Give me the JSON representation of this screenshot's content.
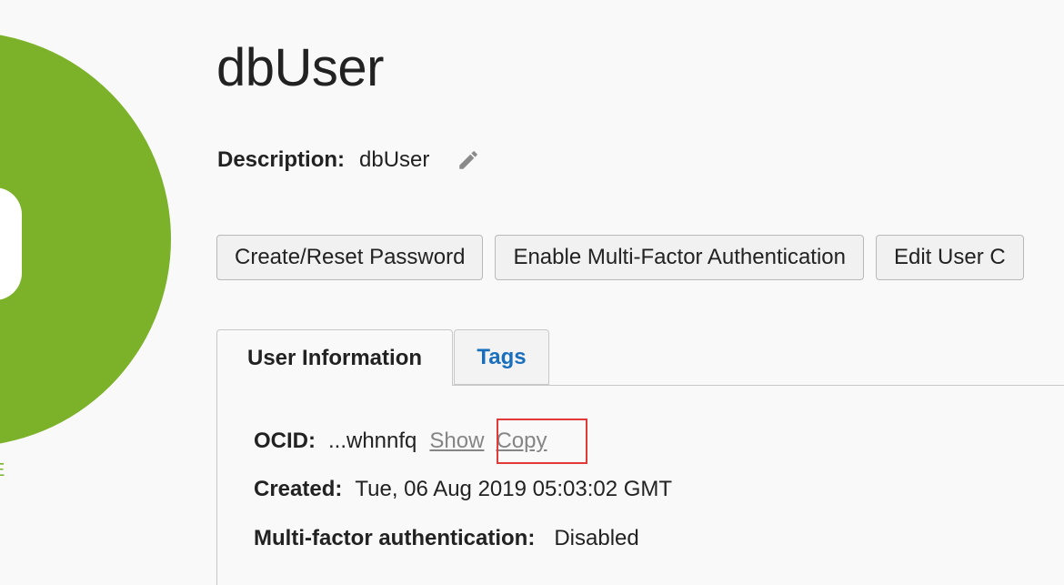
{
  "header": {
    "title": "dbUser",
    "status_fragment": "E"
  },
  "description": {
    "label": "Description:",
    "value": "dbUser",
    "edit_icon": "pencil-icon"
  },
  "actions": {
    "create_reset_password": "Create/Reset Password",
    "enable_mfa": "Enable Multi-Factor Authentication",
    "edit_user": "Edit User C"
  },
  "tabs": [
    {
      "label": "User Information",
      "active": true
    },
    {
      "label": "Tags",
      "active": false
    }
  ],
  "user_info": {
    "ocid": {
      "label": "OCID:",
      "value": "...whnnfq",
      "show_label": "Show",
      "copy_label": "Copy"
    },
    "created": {
      "label": "Created:",
      "value": "Tue, 06 Aug 2019 05:03:02 GMT"
    },
    "mfa": {
      "label": "Multi-factor authentication:",
      "value": "Disabled"
    }
  },
  "colors": {
    "avatar_green": "#7cb22a",
    "tab_link_blue": "#1a6fbd",
    "highlight_red": "#e23a3a",
    "link_gray": "#858585"
  }
}
